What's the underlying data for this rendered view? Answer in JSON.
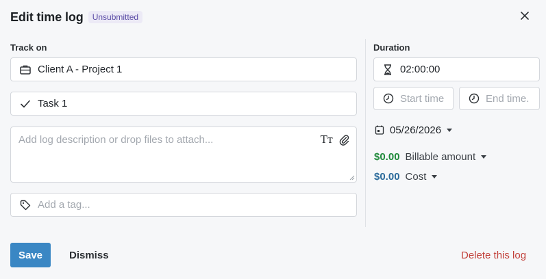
{
  "header": {
    "title": "Edit time log",
    "status_badge": "Unsubmitted"
  },
  "track_on": {
    "label": "Track on",
    "project": "Client A - Project 1",
    "task": "Task 1"
  },
  "description": {
    "placeholder": "Add log description or drop files to attach...",
    "format_icon_text": "Tт"
  },
  "tag": {
    "placeholder": "Add a tag..."
  },
  "duration": {
    "label": "Duration",
    "value": "02:00:00",
    "start_placeholder": "Start time",
    "end_placeholder": "End time."
  },
  "date": {
    "value": "05/26/2026"
  },
  "billable": {
    "amount": "$0.00",
    "label": "Billable amount",
    "color": "#1f8a3b"
  },
  "cost": {
    "amount": "$0.00",
    "label": "Cost",
    "color": "#2a6a9a"
  },
  "footer": {
    "save_label": "Save",
    "dismiss_label": "Dismiss",
    "delete_label": "Delete this log"
  },
  "colors": {
    "accent": "#3a87c4",
    "danger": "#c2413b",
    "badge_bg": "#eceaf6",
    "badge_text": "#5b4ca6"
  }
}
